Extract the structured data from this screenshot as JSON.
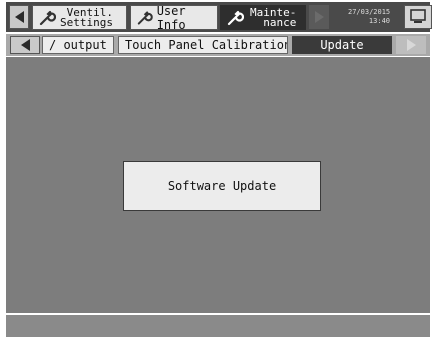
{
  "header": {
    "tabs": [
      {
        "label_line1": "Ventil.",
        "label_line2": "Settings"
      },
      {
        "label": "User Info"
      },
      {
        "label_line1": "Mainte-",
        "label_line2": "nance"
      }
    ],
    "date": "27/03/2015",
    "time": "13:40"
  },
  "subtabs": [
    {
      "label": "/ output"
    },
    {
      "label": "Touch Panel Calibration"
    },
    {
      "label": "Update"
    }
  ],
  "main": {
    "software_update_label": "Software Update"
  },
  "colors": {
    "topbar": "#4a4a4a",
    "active_tab": "#2e2e2e",
    "main_bg": "#7d7d7d"
  }
}
